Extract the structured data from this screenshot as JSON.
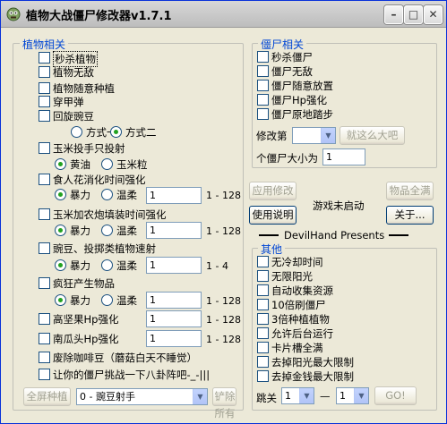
{
  "window": {
    "title": "植物大战僵尸修改器v1.7.1",
    "min_label": "–",
    "max_label": "□",
    "close_label": "✕"
  },
  "plant": {
    "legend": "植物相关",
    "items": [
      {
        "label": "秒杀植物",
        "checked": false
      },
      {
        "label": "植物无敌",
        "checked": false
      },
      {
        "label": "植物随意种植",
        "checked": false
      },
      {
        "label": "穿甲弹",
        "checked": false
      },
      {
        "label": "回旋豌豆",
        "checked": false
      }
    ],
    "pea_modes": [
      "方式一",
      "方式二"
    ],
    "corn": {
      "label": "玉米投手只投射",
      "opts": [
        "黄油",
        "玉米粒"
      ]
    },
    "flower": {
      "label": "食人花消化时间强化",
      "opts": [
        "暴力",
        "温柔"
      ],
      "value": "1",
      "range": "1 - 128"
    },
    "cob": {
      "label": "玉米加农炮填装时间强化",
      "opts": [
        "暴力",
        "温柔"
      ],
      "value": "1",
      "range": "1 - 128"
    },
    "speed": {
      "label": "豌豆、投掷类植物速射",
      "opts": [
        "暴力",
        "温柔"
      ],
      "value": "1",
      "range": "1 - 4"
    },
    "produce": {
      "label": "疯狂产生物品",
      "opts": [
        "暴力",
        "温柔"
      ],
      "value": "1",
      "range": "1 - 128"
    },
    "tallnut": {
      "label": "高坚果Hp强化",
      "value": "1",
      "range": "1 - 128"
    },
    "pumpkin": {
      "label": "南瓜头Hp强化",
      "value": "1",
      "range": "1 - 128"
    },
    "coffee": "废除咖啡豆（蘑菇白天不睡觉）",
    "bagua": "让你的僵尸挑战一下八卦阵吧-_-|||",
    "fill_button": "全屏种植",
    "plant_select": "0 - 豌豆射手",
    "remove_button": "铲除所有"
  },
  "zombie": {
    "legend": "僵尸相关",
    "items": [
      {
        "label": "秒杀僵尸",
        "checked": false
      },
      {
        "label": "僵尸无敌",
        "checked": false
      },
      {
        "label": "僵尸随意放置",
        "checked": false
      },
      {
        "label": "僵尸Hp强化",
        "checked": false
      },
      {
        "label": "僵尸原地踏步",
        "checked": false
      }
    ],
    "modify_label": "修改第",
    "big_button": "就这么大吧",
    "size_label": "个僵尸大小为",
    "size_value": "1"
  },
  "controls": {
    "apply_button": "应用修改",
    "status": "游戏未启动",
    "plants_full_button": "物品全满",
    "help_button": "使用说明",
    "about_button": "关于...",
    "presents": "DevilHand Presents"
  },
  "other": {
    "legend": "其他",
    "items": [
      {
        "label": "无冷却时间",
        "checked": false
      },
      {
        "label": "无限阳光",
        "checked": false
      },
      {
        "label": "自动收集资源",
        "checked": false
      },
      {
        "label": "10倍刷僵尸",
        "checked": false
      },
      {
        "label": "3倍种植植物",
        "checked": false
      },
      {
        "label": "允许后台运行",
        "checked": false
      },
      {
        "label": "卡片槽全满",
        "checked": false
      },
      {
        "label": "去掉阳光最大限制",
        "checked": false
      },
      {
        "label": "去掉金钱最大限制",
        "checked": false
      }
    ],
    "jump_label": "跳关",
    "level_a": "1",
    "dash": "—",
    "level_b": "1",
    "go_button": "GO!"
  }
}
